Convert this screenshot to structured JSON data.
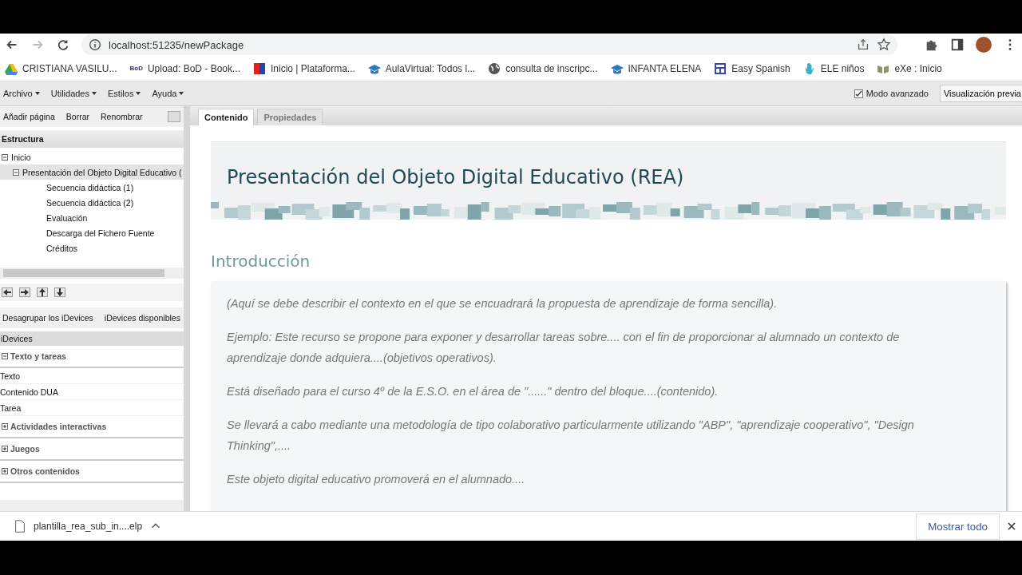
{
  "browser": {
    "url": "localhost:51235/newPackage",
    "bookmarks": [
      {
        "label": "CRISTIANA VASILU..."
      },
      {
        "label": "Upload: BoD - Book...",
        "logo_text": "BoD"
      },
      {
        "label": "Inicio | Plataforma..."
      },
      {
        "label": "AulaVirtual: Todos l..."
      },
      {
        "label": "consulta de inscripc..."
      },
      {
        "label": "INFANTA ELENA"
      },
      {
        "label": "Easy Spanish"
      },
      {
        "label": "ELE niños"
      },
      {
        "label": "eXe : Inicio"
      }
    ]
  },
  "menu": {
    "items": [
      "Archivo",
      "Utilidades",
      "Estilos",
      "Ayuda"
    ],
    "advanced_mode": {
      "label": "Modo avanzado",
      "checked": true
    },
    "preview_button": "Visualización previa"
  },
  "structure": {
    "actions": [
      "Añadir página",
      "Borrar",
      "Renombrar"
    ],
    "title": "Estructura",
    "tree": [
      {
        "label": "Inicio",
        "expanded": true,
        "selected": false,
        "children": [
          {
            "label": "Presentación del Objeto Digital Educativo (",
            "expanded": true,
            "selected": true,
            "children": [
              {
                "label": "Secuencia didáctica (1)",
                "selected": false
              },
              {
                "label": "Secuencia didáctica (2)",
                "selected": false
              },
              {
                "label": "Evaluación",
                "selected": false
              },
              {
                "label": "Descarga del Fichero Fuente",
                "selected": false
              },
              {
                "label": "Créditos",
                "selected": false
              }
            ]
          }
        ]
      }
    ]
  },
  "idevices": {
    "actions": [
      "Desagrupar los iDevices",
      "iDevices disponibles"
    ],
    "title": "iDevices",
    "groups": [
      {
        "label": "Texto y tareas",
        "expanded": true,
        "items": [
          "Texto",
          "Contenido DUA",
          "Tarea"
        ]
      },
      {
        "label": "Actividades interactivas",
        "expanded": false
      },
      {
        "label": "Juegos",
        "expanded": false
      },
      {
        "label": "Otros contenidos",
        "expanded": false
      }
    ]
  },
  "tabs": [
    {
      "label": "Contenido",
      "selected": true
    },
    {
      "label": "Propiedades",
      "selected": false
    }
  ],
  "page": {
    "title": "Presentación del Objeto Digital Educativo (REA)",
    "section": "Introducción",
    "paragraphs": [
      "(Aquí se debe describir  el contexto en el que se encuadrará la propuesta de aprendizaje de forma sencilla).",
      "Ejemplo: Este recurso se propone para exponer y desarrollar tareas sobre.... con el fin de proporcionar al alumnado un contexto de aprendizaje donde adquiera....(objetivos operativos).",
      "Está diseñado para el curso 4º de la E.S.O. en el área de \"......\" dentro del bloque....(contenido).",
      "Se llevará a cabo mediante una metodología de tipo colaborativo particularmente utilizando \"ABP\", \"aprendizaje cooperativo\", \"Design Thinking\",....",
      "Este objeto digital educativo promoverá en el alumnado...."
    ]
  },
  "downloads": {
    "file": "plantilla_rea_sub_in....elp",
    "show_all": "Mostrar todo"
  }
}
